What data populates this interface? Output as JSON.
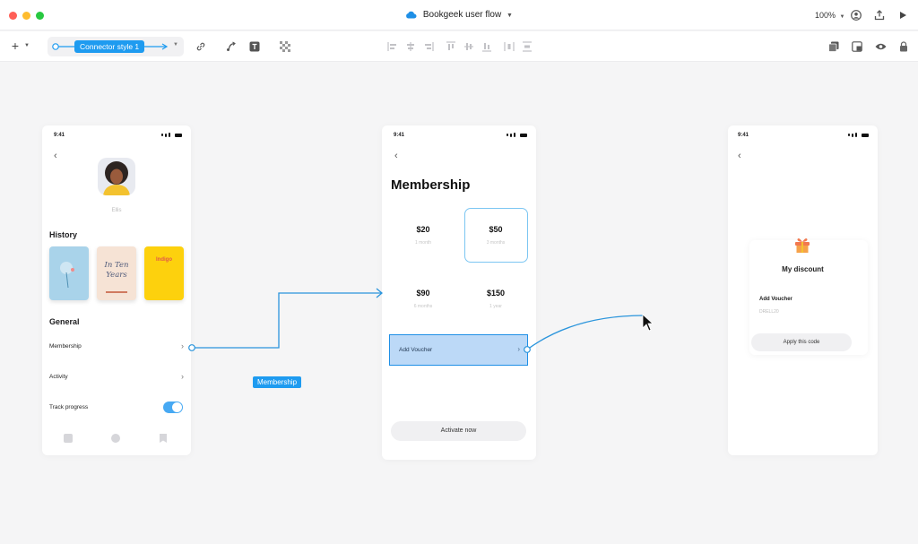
{
  "window": {
    "title": "Bookgeek user flow",
    "zoom": "100%",
    "traffic_colors": [
      "#ff5f57",
      "#febc2e",
      "#28c840"
    ]
  },
  "toolbar": {
    "connector_style": "Connector style 1"
  },
  "colors": {
    "accent": "#1e9bf0",
    "connector": "#2b95dc",
    "selection_fill": "#bcd9f7",
    "toggle_on": "#47a9f3"
  },
  "screen_profile": {
    "time": "9:41",
    "user_name": "Ellis",
    "history_title": "History",
    "books": [
      {
        "title": "",
        "cover_color": "#a9d3ea"
      },
      {
        "title": "In Ten Years",
        "cover_color": "#f6e3d5"
      },
      {
        "title": "Indigo",
        "cover_color": "#fdd10d"
      }
    ],
    "general_title": "General",
    "rows": [
      {
        "label": "Membership"
      },
      {
        "label": "Activity"
      },
      {
        "label": "Track progress"
      }
    ],
    "track_progress_on": true
  },
  "screen_membership": {
    "time": "9:41",
    "title": "Membership",
    "plans": [
      {
        "price": "$20",
        "period": "1 month"
      },
      {
        "price": "$50",
        "period": "3 months"
      },
      {
        "price": "$90",
        "period": "6 months"
      },
      {
        "price": "$150",
        "period": "1 year"
      }
    ],
    "selected_plan_index": 1,
    "voucher_label": "Add Voucher",
    "activate_label": "Activate now"
  },
  "screen_discount": {
    "time": "9:41",
    "title": "My discount",
    "voucher_label": "Add Voucher",
    "voucher_code": "DRELL20",
    "apply_label": "Apply this code"
  },
  "connector_label": "Membership"
}
